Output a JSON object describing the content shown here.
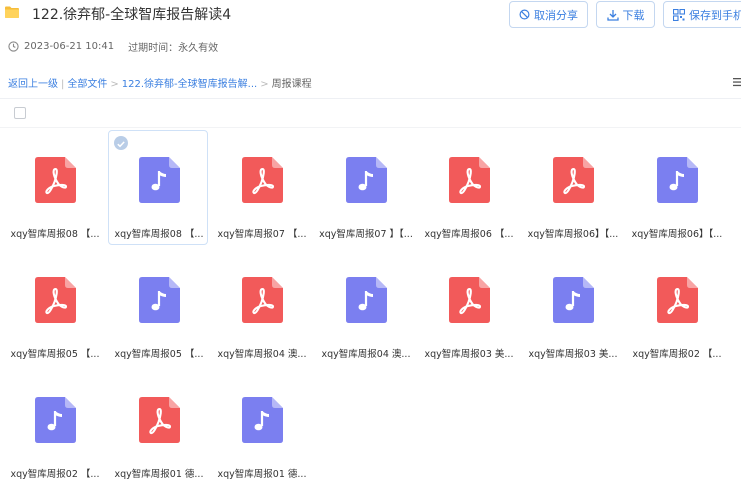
{
  "header": {
    "title": "122.徐弃郁-全球智库报告解读4",
    "date": "2023-06-21 10:41",
    "expiry_label": "过期时间：",
    "expiry_value": "永久有效"
  },
  "actions": {
    "cancel_share": "取消分享",
    "download": "下载",
    "save_to_phone": "保存到手机"
  },
  "breadcrumb": {
    "back": "返回上一级",
    "all_files": "全部文件",
    "folder": "122.徐弃郁-全球智库报告解...",
    "current": "周报课程"
  },
  "colors": {
    "pdf": "#f25a5a",
    "audio": "#7b7ff0",
    "accent": "#3b7fe0"
  },
  "files": [
    {
      "name": "xqy智库周报08 【...",
      "type": "pdf"
    },
    {
      "name": "xqy智库周报08 【...",
      "type": "audio"
    },
    {
      "name": "xqy智库周报07 【...",
      "type": "pdf"
    },
    {
      "name": "xqy智库周报07 】【...",
      "type": "audio"
    },
    {
      "name": "xqy智库周报06 【...",
      "type": "pdf"
    },
    {
      "name": "xqy智库周报06】【...",
      "type": "pdf"
    },
    {
      "name": "xqy智库周报06】【...",
      "type": "audio"
    },
    {
      "name": "xqy智库周报05 【...",
      "type": "pdf"
    },
    {
      "name": "xqy智库周报05 【...",
      "type": "audio"
    },
    {
      "name": "xqy智库周报04 澳...",
      "type": "pdf"
    },
    {
      "name": "xqy智库周报04 澳...",
      "type": "audio"
    },
    {
      "name": "xqy智库周报03 美...",
      "type": "pdf"
    },
    {
      "name": "xqy智库周报03 美...",
      "type": "audio"
    },
    {
      "name": "xqy智库周报02 【...",
      "type": "pdf"
    },
    {
      "name": "xqy智库周报02 【...",
      "type": "audio"
    },
    {
      "name": "xqy智库周报01 德...",
      "type": "pdf"
    },
    {
      "name": "xqy智库周报01 德...",
      "type": "audio"
    }
  ]
}
